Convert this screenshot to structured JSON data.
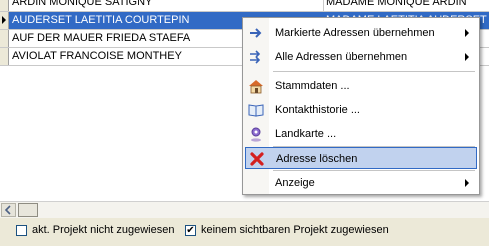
{
  "rows": [
    {
      "name": "ARDIN MONIQUE SATIGNY",
      "address": "MADAME MONIQUE ARDIN"
    },
    {
      "name": "AUDERSET LAETITIA COURTEPIN",
      "address": "MADAME LAETITIA AUDERSET"
    },
    {
      "name": "AUF DER MAUER FRIEDA STAEFA",
      "address": ""
    },
    {
      "name": "AVIOLAT FRANCOISE MONTHEY",
      "address": ""
    }
  ],
  "context_menu": {
    "items": [
      {
        "label": "Markierte Adressen übernehmen",
        "icon": "arrow-right-icon",
        "submenu": true
      },
      {
        "label": "Alle Adressen übernehmen",
        "icon": "double-arrow-right-icon",
        "submenu": true
      },
      {
        "label": "Stammdaten ...",
        "icon": "house-icon",
        "submenu": false
      },
      {
        "label": "Kontakthistorie ...",
        "icon": "book-icon",
        "submenu": false
      },
      {
        "label": "Landkarte ...",
        "icon": "map-pin-icon",
        "submenu": false
      },
      {
        "label": "Adresse löschen",
        "icon": "delete-x-icon",
        "submenu": false,
        "highlighted": true
      },
      {
        "label": "Anzeige",
        "icon": "",
        "submenu": true
      }
    ]
  },
  "status": {
    "checkbox1": {
      "label": "akt. Projekt nicht zugewiesen",
      "checked": false
    },
    "checkbox2": {
      "label": "keinem sichtbaren Projekt zugewiesen",
      "checked": true,
      "mark": "✔"
    }
  },
  "colors": {
    "selection": "#316ac5",
    "menu_highlight": "#c1d2ee",
    "delete_red": "#d42020"
  }
}
